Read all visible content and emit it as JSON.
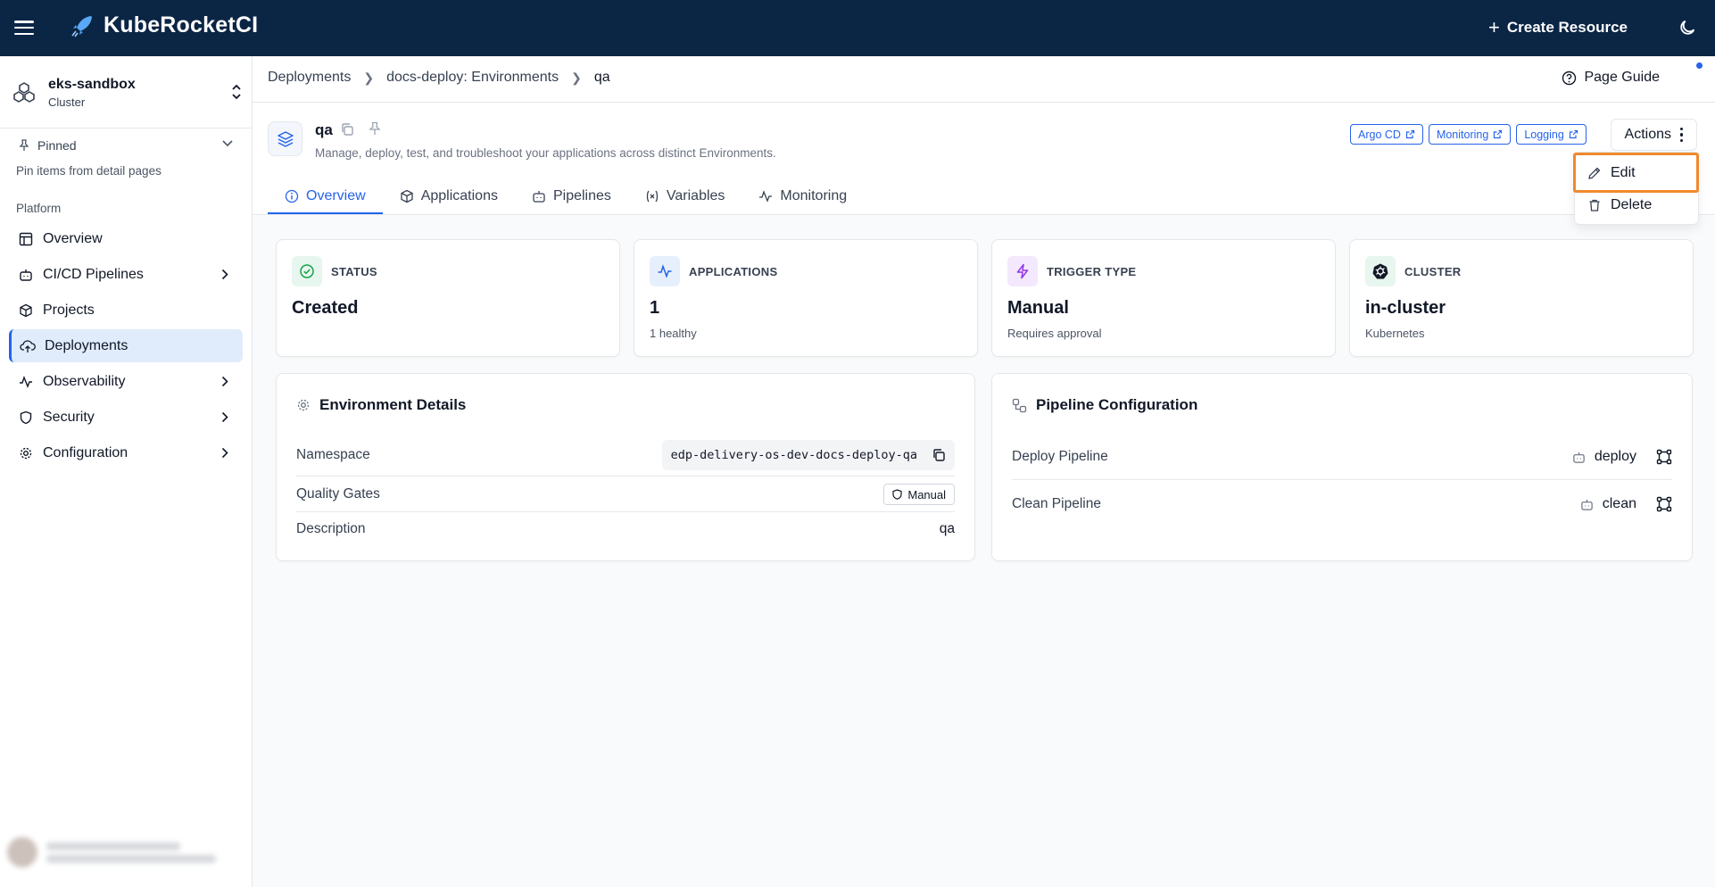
{
  "app": {
    "brand": "KubeRocketCI",
    "create_label": "Create Resource"
  },
  "sidebar": {
    "cluster": {
      "name": "eks-sandbox",
      "subtitle": "Cluster"
    },
    "pinned": {
      "label": "Pinned",
      "hint": "Pin items from detail pages"
    },
    "section_label": "Platform",
    "items": [
      {
        "label": "Overview",
        "icon": "table-icon"
      },
      {
        "label": "CI/CD Pipelines",
        "icon": "bot-icon"
      },
      {
        "label": "Projects",
        "icon": "box-icon"
      },
      {
        "label": "Deployments",
        "icon": "cloud-upload-icon"
      },
      {
        "label": "Observability",
        "icon": "activity-icon"
      },
      {
        "label": "Security",
        "icon": "shield-icon"
      },
      {
        "label": "Configuration",
        "icon": "gear-icon"
      }
    ]
  },
  "breadcrumb": {
    "items": [
      "Deployments",
      "docs-deploy: Environments",
      "qa"
    ]
  },
  "page_guide": "Page Guide",
  "environment": {
    "name": "qa",
    "description": "Manage, deploy, test, and troubleshoot your applications across distinct Environments."
  },
  "external_links": [
    "Argo CD",
    "Monitoring",
    "Logging"
  ],
  "actions": {
    "label": "Actions",
    "menu": {
      "edit": "Edit",
      "delete": "Delete"
    }
  },
  "tabs": [
    "Overview",
    "Applications",
    "Pipelines",
    "Variables",
    "Monitoring"
  ],
  "stats": [
    {
      "label": "STATUS",
      "value": "Created",
      "sub": ""
    },
    {
      "label": "APPLICATIONS",
      "value": "1",
      "sub": "1 healthy"
    },
    {
      "label": "TRIGGER TYPE",
      "value": "Manual",
      "sub": "Requires approval"
    },
    {
      "label": "CLUSTER",
      "value": "in-cluster",
      "sub": "Kubernetes"
    }
  ],
  "env_details": {
    "title": "Environment Details",
    "namespace_label": "Namespace",
    "namespace_value": "edp-delivery-os-dev-docs-deploy-qa",
    "quality_gates_label": "Quality Gates",
    "quality_gates_value": "Manual",
    "description_label": "Description",
    "description_value": "qa"
  },
  "pipeline_config": {
    "title": "Pipeline Configuration",
    "deploy_label": "Deploy Pipeline",
    "deploy_value": "deploy",
    "clean_label": "Clean Pipeline",
    "clean_value": "clean"
  },
  "colors": {
    "topbar": "#0b2545",
    "accent": "#2563eb",
    "highlight": "#f0892c"
  }
}
